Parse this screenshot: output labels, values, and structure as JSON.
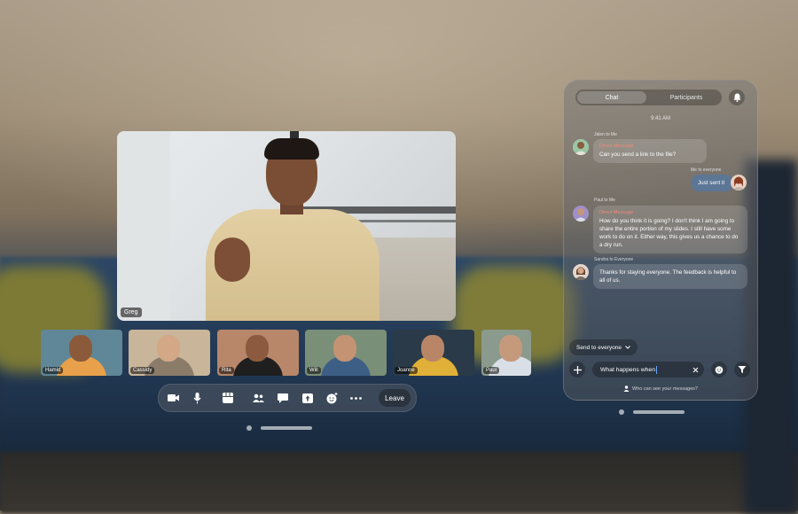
{
  "main_video": {
    "name": "Greg"
  },
  "participants": [
    {
      "name": "Hamid",
      "bg": "#5f8797",
      "shirt": "#e9a04a",
      "skin": "#8a5a3b"
    },
    {
      "name": "Cassidy",
      "bg": "#c9b59a",
      "shirt": "#8b7c6a",
      "skin": "#d2a886"
    },
    {
      "name": "Rita",
      "bg": "#b8876a",
      "shirt": "#1f1f1f",
      "skin": "#8c5b3f"
    },
    {
      "name": "Will",
      "bg": "#7a8f78",
      "shirt": "#3d5f86",
      "skin": "#c49373"
    },
    {
      "name": "Joanne",
      "bg": "#2a3a48",
      "shirt": "#e0b038",
      "skin": "#b98567"
    },
    {
      "name": "Paul",
      "bg": "#8a9a8c",
      "shirt": "#d9dfe6",
      "skin": "#c59a7c"
    }
  ],
  "toolbar": {
    "icons": [
      "video-icon",
      "microphone-icon",
      "grid-icon",
      "people-icon",
      "chat-icon",
      "share-icon",
      "reaction-icon",
      "more-icon"
    ],
    "leave_label": "Leave"
  },
  "chat": {
    "tab_chat": "Chat",
    "tab_participants": "Participants",
    "time": "9:41 AM",
    "messages": [
      {
        "meta": "Jalen to Me",
        "tag": "Direct Message",
        "text": "Can you send a link to the file?"
      },
      {
        "meta": "Me to everyone",
        "text": "Just sent it"
      },
      {
        "meta": "Paul to Me",
        "tag": "Direct Message",
        "text": "How do you think it is going? I don't think I am going to share the entire portion of my slides. I still have some work to do on it. Either way, this gives us a chance to do a dry run."
      },
      {
        "meta": "Sandra to Everyone",
        "text": "Thanks for staying everyone. The feedback is helpful to all of us."
      }
    ],
    "send_to": "Send to everyone",
    "input_value": "What happens when",
    "who_can_see": "Who can see your messages?"
  },
  "colors": {
    "accent": "#6aa8ff",
    "dm": "#f08a7a",
    "my_bubble": "#5578a0"
  }
}
